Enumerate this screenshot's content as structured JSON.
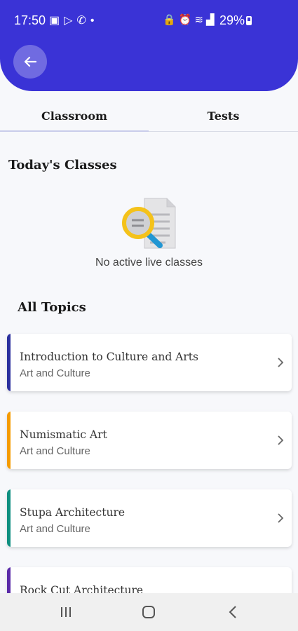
{
  "status_bar": {
    "time": "17:50",
    "left_icons": [
      "gallery-icon",
      "play-store-icon",
      "missed-call-icon",
      "dot-icon"
    ],
    "right_icons": [
      "lock-icon",
      "alarm-icon",
      "wifi-icon",
      "signal-icon"
    ],
    "battery": "29%"
  },
  "tabs": [
    {
      "label": "Classroom"
    },
    {
      "label": "Tests"
    }
  ],
  "today": {
    "title": "Today's Classes",
    "empty_text": "No active live classes"
  },
  "topics": {
    "title": "All Topics",
    "items": [
      {
        "title": "Introduction to Culture and Arts",
        "subtitle": "Art and Culture",
        "color": "#2a2f9e"
      },
      {
        "title": "Numismatic Art",
        "subtitle": "Art and Culture",
        "color": "#f59b00"
      },
      {
        "title": "Stupa Architecture",
        "subtitle": "Art and Culture",
        "color": "#0f8f80"
      },
      {
        "title": "Rock Cut Architecture",
        "subtitle": "",
        "color": "#5a2aa8"
      }
    ]
  },
  "colors": {
    "header": "#3a33d6",
    "background": "#f7f8fb"
  }
}
